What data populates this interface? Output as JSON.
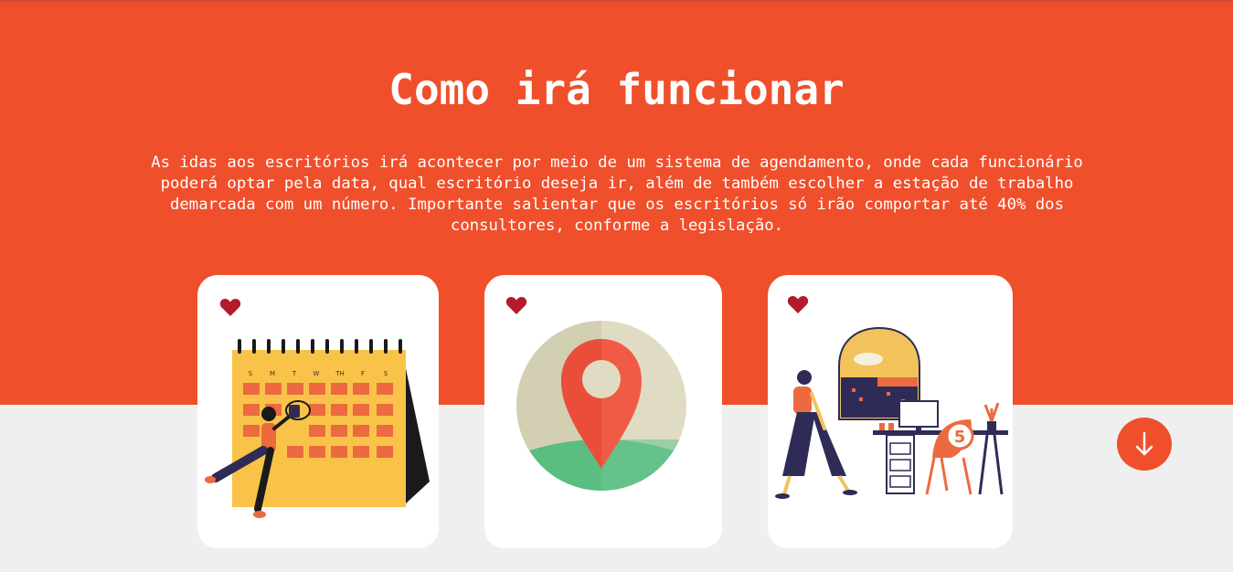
{
  "section": {
    "title": "Como irá funcionar",
    "description": "As idas aos escritórios irá acontecer por meio de um sistema de agendamento, onde cada funcionário poderá optar pela data, qual escritório deseja ir, além de também escolher a estação de trabalho demarcada com um número. Importante salientar que os escritórios só irão comportar até 40% dos consultores, conforme a legislação."
  },
  "cards": [
    {
      "icon": "heart-icon",
      "illustration": "calendar-illustration"
    },
    {
      "icon": "heart-icon",
      "illustration": "location-pin-illustration"
    },
    {
      "icon": "heart-icon",
      "illustration": "workstation-illustration",
      "workstation_number": "5"
    }
  ],
  "calendar_days": [
    "S",
    "M",
    "T",
    "W",
    "TH",
    "F",
    "S"
  ],
  "scroll_button": {
    "icon": "arrow-down-icon"
  },
  "colors": {
    "primary": "#f04f2b",
    "background": "#efefef",
    "card": "#ffffff",
    "heart": "#b51a2c"
  }
}
